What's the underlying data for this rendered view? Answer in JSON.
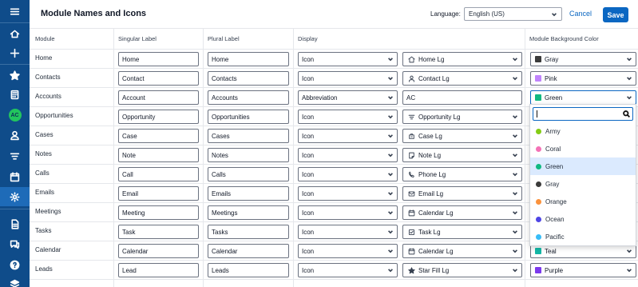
{
  "header": {
    "title": "Module Names and Icons",
    "language_label": "Language:",
    "language_value": "English (US)",
    "cancel_label": "Cancel",
    "save_label": "Save"
  },
  "sidebar": {
    "items": [
      {
        "name": "menu-icon"
      },
      {
        "name": "home-icon"
      },
      {
        "name": "plus-icon"
      },
      {
        "name": "star-icon"
      },
      {
        "name": "calculator-icon"
      },
      {
        "name": "avatar",
        "initials": "AC"
      },
      {
        "name": "user-icon"
      },
      {
        "name": "filter-icon"
      },
      {
        "name": "calendar-icon"
      },
      {
        "name": "gear-icon"
      },
      {
        "name": "document-icon"
      },
      {
        "name": "chat-icon"
      },
      {
        "name": "help-icon"
      },
      {
        "name": "layers-icon"
      }
    ]
  },
  "columns": {
    "module": "Module",
    "singular": "Singular Label",
    "plural": "Plural Label",
    "display": "Display",
    "color": "Module Background Color"
  },
  "rows": [
    {
      "module": "Home",
      "singular": "Home",
      "plural": "Home",
      "display": "Icon",
      "icon": "Home Lg",
      "icon_name": "home-icon",
      "color": "Gray",
      "color_hex": "#3b3b3b"
    },
    {
      "module": "Contacts",
      "singular": "Contact",
      "plural": "Contacts",
      "display": "Icon",
      "icon": "Contact Lg",
      "icon_name": "user-icon",
      "color": "Pink",
      "color_hex": "#c084fc"
    },
    {
      "module": "Accounts",
      "singular": "Account",
      "plural": "Accounts",
      "display": "Abbreviation",
      "icon": "AC",
      "icon_name": "",
      "color": "Green",
      "color_hex": "#10b981"
    },
    {
      "module": "Opportunities",
      "singular": "Opportunity",
      "plural": "Opportunities",
      "display": "Icon",
      "icon": "Opportunity Lg",
      "icon_name": "filter-icon"
    },
    {
      "module": "Cases",
      "singular": "Case",
      "plural": "Cases",
      "display": "Icon",
      "icon": "Case Lg",
      "icon_name": "case-icon"
    },
    {
      "module": "Notes",
      "singular": "Note",
      "plural": "Notes",
      "display": "Icon",
      "icon": "Note Lg",
      "icon_name": "note-icon"
    },
    {
      "module": "Calls",
      "singular": "Call",
      "plural": "Calls",
      "display": "Icon",
      "icon": "Phone Lg",
      "icon_name": "phone-icon"
    },
    {
      "module": "Emails",
      "singular": "Email",
      "plural": "Emails",
      "display": "Icon",
      "icon": "Email Lg",
      "icon_name": "email-icon"
    },
    {
      "module": "Meetings",
      "singular": "Meeting",
      "plural": "Meetings",
      "display": "Icon",
      "icon": "Calendar Lg",
      "icon_name": "calendar-icon"
    },
    {
      "module": "Tasks",
      "singular": "Task",
      "plural": "Tasks",
      "display": "Icon",
      "icon": "Task Lg",
      "icon_name": "task-icon"
    },
    {
      "module": "Calendar",
      "singular": "Calendar",
      "plural": "Calendar",
      "display": "Icon",
      "icon": "Calendar Lg",
      "icon_name": "calendar-icon",
      "color": "Teal",
      "color_hex": "#14b8a6"
    },
    {
      "module": "Leads",
      "singular": "Lead",
      "plural": "Leads",
      "display": "Icon",
      "icon": "Star Fill Lg",
      "icon_name": "star-icon",
      "color": "Purple",
      "color_hex": "#7c3aed"
    }
  ],
  "dropdown": {
    "search_value": "",
    "highlighted": "Green",
    "options": [
      {
        "label": "Army",
        "color": "#84cc16"
      },
      {
        "label": "Coral",
        "color": "#f472b6"
      },
      {
        "label": "Green",
        "color": "#10b981"
      },
      {
        "label": "Gray",
        "color": "#3b3b3b"
      },
      {
        "label": "Orange",
        "color": "#fb923c"
      },
      {
        "label": "Ocean",
        "color": "#4f46e5"
      },
      {
        "label": "Pacific",
        "color": "#38bdf8"
      }
    ]
  },
  "colors": {
    "sidebar": "#0f4c8a",
    "accent": "#0b67c2"
  }
}
